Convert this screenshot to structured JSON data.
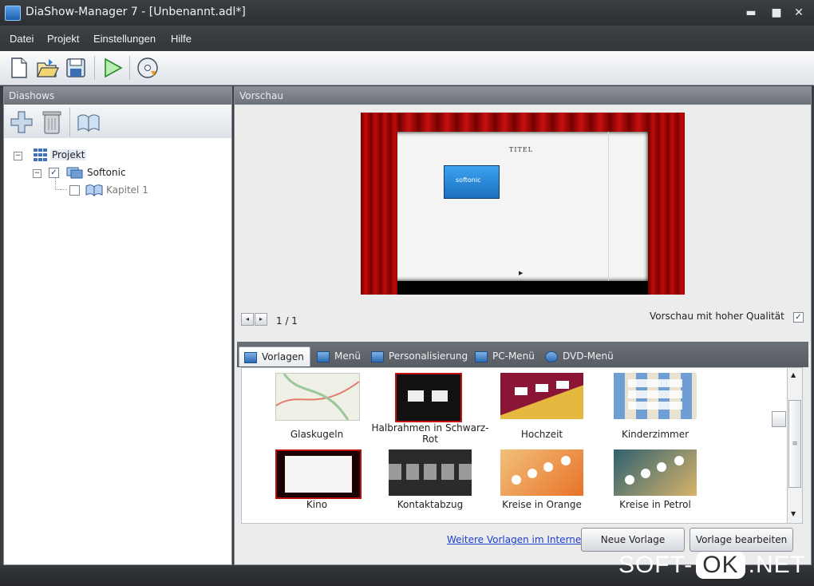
{
  "window": {
    "title": "DiaShow-Manager 7 - [Unbenannt.adl*]",
    "minimize": "▬",
    "maximize": "■",
    "close": "✕"
  },
  "menu": [
    "Datei",
    "Projekt",
    "Einstellungen",
    "Hilfe"
  ],
  "toolbar": {
    "icons": [
      "new-file-icon",
      "open-folder-icon",
      "save-icon",
      "play-icon",
      "burn-disc-icon"
    ]
  },
  "left": {
    "title": "Diashows",
    "tools": [
      "add-icon",
      "delete-icon",
      "book-icon"
    ],
    "tree": {
      "root": "Projekt",
      "child": "Softonic",
      "child_checked": "✓",
      "grandchild": "Kapitel 1",
      "expander": "−"
    }
  },
  "preview": {
    "title": "Vorschau",
    "slide_heading": "TITEL",
    "slide_brand": "softonic",
    "prev": "◂",
    "next": "▸",
    "page": "1 / 1",
    "quality_label": "Vorschau mit hoher Qualität",
    "quality_checked": "✓"
  },
  "tabs": [
    "Vorlagen",
    "Menü",
    "Personalisierung",
    "PC-Menü",
    "DVD-Menü"
  ],
  "templates": [
    {
      "name": "Glaskugeln",
      "colors": [
        "#eef0e6",
        "#e67a6a"
      ]
    },
    {
      "name": "Halbrahmen in Schwarz-Rot",
      "colors": [
        "#111111",
        "#c51111"
      ]
    },
    {
      "name": "Hochzeit",
      "colors": [
        "#8a1535",
        "#e5b940"
      ]
    },
    {
      "name": "Kinderzimmer",
      "colors": [
        "#6e9ed3",
        "#e8e2cf"
      ]
    },
    {
      "name": "Kino",
      "colors": [
        "#1a0000",
        "#b80c0c"
      ]
    },
    {
      "name": "Kontaktabzug",
      "colors": [
        "#2b2b2b",
        "#9a9a9a"
      ]
    },
    {
      "name": "Kreise in Orange",
      "colors": [
        "#f2c07a",
        "#e8732a"
      ]
    },
    {
      "name": "Kreise in Petrol",
      "colors": [
        "#2e6170",
        "#d8b36a"
      ]
    }
  ],
  "scroll": {
    "up": "▲",
    "down": "▼",
    "grip": "≡"
  },
  "bottom": {
    "link": "Weitere Vorlagen im Internet",
    "new_template": "Neue Vorlage",
    "edit_template": "Vorlage bearbeiten"
  },
  "watermark": {
    "left": "SOFT-",
    "mid": "OK",
    "right": ".NET"
  }
}
